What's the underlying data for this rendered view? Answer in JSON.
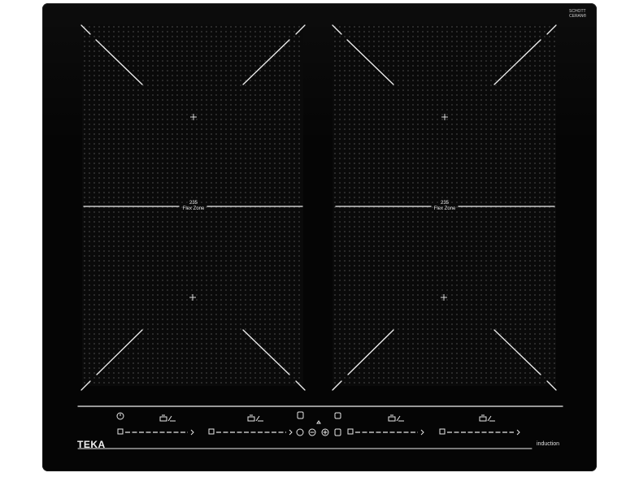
{
  "brand": "TEKA",
  "badge": {
    "line1": "SCHOTT",
    "line2": "CERAN®"
  },
  "footer_label": "induction",
  "zones": {
    "left": {
      "size": "235",
      "name": "Flex Zone"
    },
    "right": {
      "size": "235",
      "name": "Flex Zone"
    }
  },
  "colors": {
    "glass": "#050505",
    "markings": "#f0f0f0",
    "dots": "#3a3a3a"
  },
  "controls": {
    "icons": [
      "power-icon",
      "lock-icon",
      "timer-icon",
      "minus-icon",
      "plus-icon",
      "pause-icon",
      "pot-icon",
      "slider-icon"
    ]
  }
}
